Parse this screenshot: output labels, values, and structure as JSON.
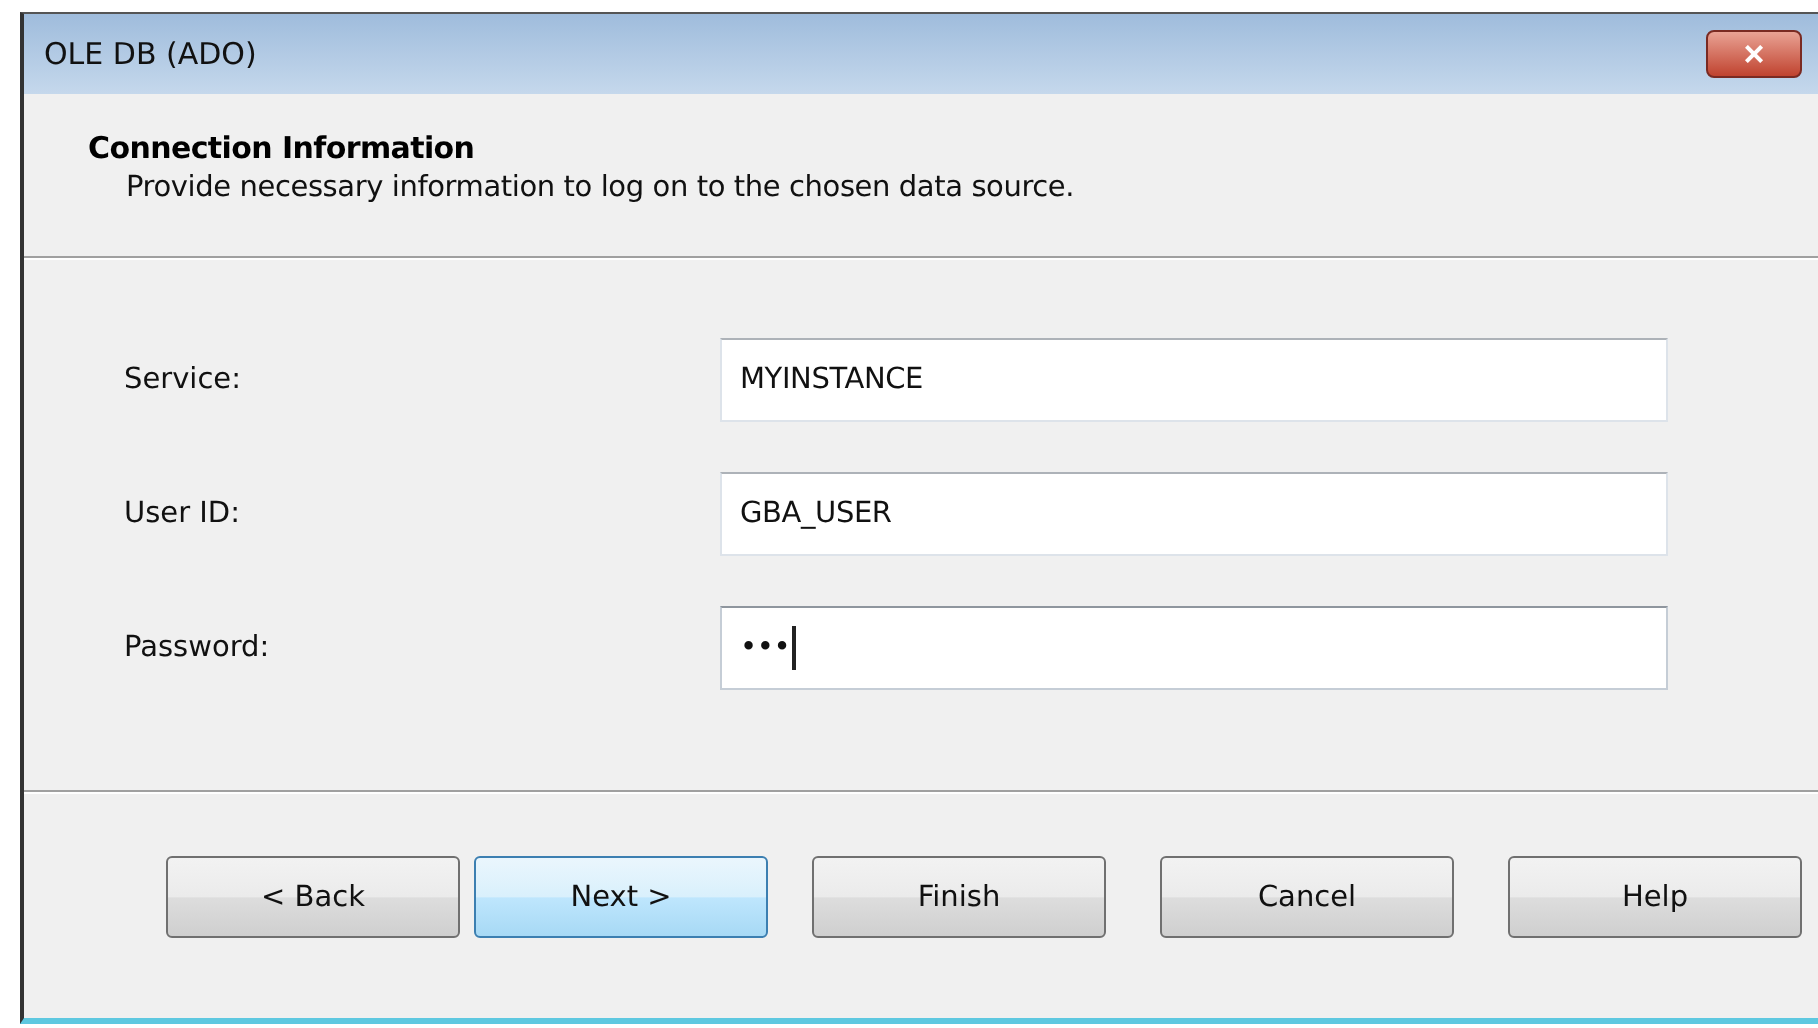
{
  "window": {
    "title": "OLE DB (ADO)",
    "close": "×"
  },
  "header": {
    "title": "Connection Information",
    "subtitle": "Provide necessary information to log on to the chosen data source."
  },
  "fields": [
    {
      "label": "Service:",
      "value": "MYINSTANCE",
      "focused": false
    },
    {
      "label": "User ID:",
      "value": "GBA_USER",
      "focused": false
    },
    {
      "label": "Password:",
      "value": "•••",
      "focused": true
    }
  ],
  "buttons": [
    {
      "label": "< Back",
      "default": false
    },
    {
      "label": "Next >",
      "default": true
    },
    {
      "label": "Finish",
      "default": false
    },
    {
      "label": "Cancel",
      "default": false
    },
    {
      "label": "Help",
      "default": false
    }
  ]
}
